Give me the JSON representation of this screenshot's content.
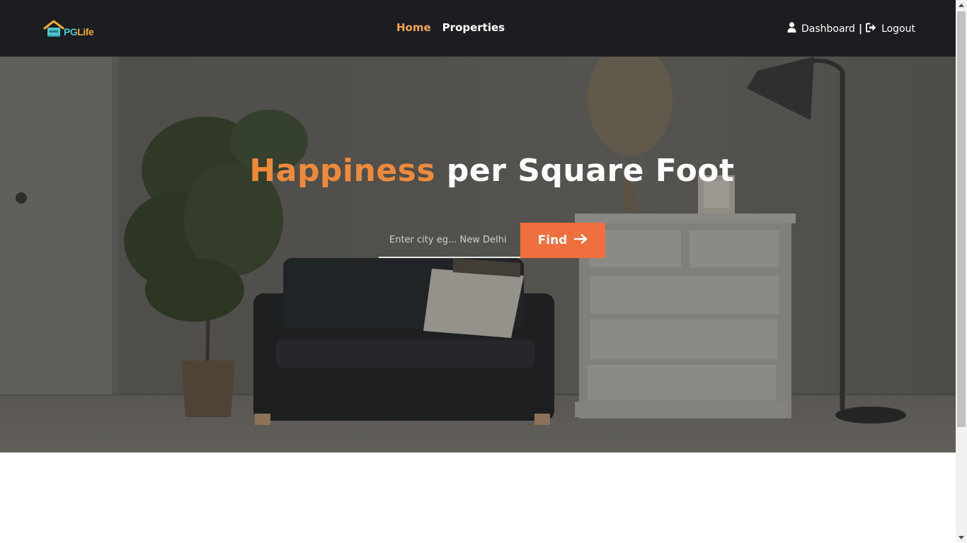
{
  "app": {
    "logo": {
      "pg": "PG",
      "life": "Life"
    }
  },
  "nav": {
    "links": [
      {
        "label": "Home",
        "active": true
      },
      {
        "label": "Properties",
        "active": false
      }
    ],
    "dashboard_label": "Dashboard",
    "separator": "|",
    "logout_label": "Logout"
  },
  "hero": {
    "title_accent": "Happiness",
    "title_rest": "per Square Foot",
    "search": {
      "placeholder": "Enter city eg... New Delhi",
      "value": ""
    },
    "find_label": "Find"
  },
  "icons": {
    "logo": "house-icon",
    "dashboard": "user-icon",
    "logout": "sign-out-icon",
    "find": "arrow-right-icon"
  },
  "colors": {
    "navbar_bg": "#1c1d21",
    "accent_orange": "#ee8a3c",
    "active_link": "#f5a356",
    "find_button": "#ef6f3e",
    "logo_teal": "#4fc3c8",
    "logo_yellow": "#f0a838"
  }
}
